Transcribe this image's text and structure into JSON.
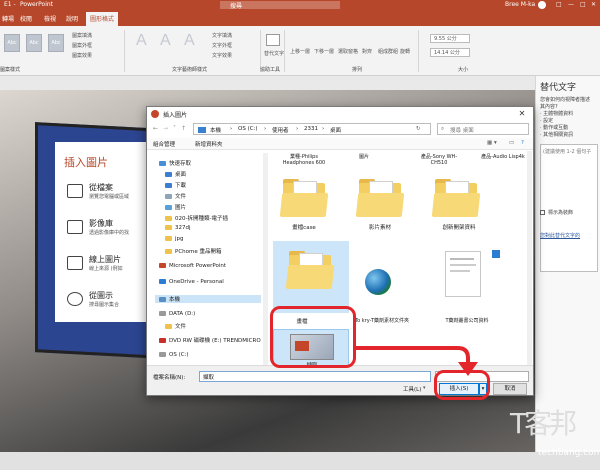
{
  "app": {
    "title": "PowerPoint",
    "title_left": "E1 - ",
    "search": "搜尋",
    "user": "Bree M-ka"
  },
  "ribbon_tabs": [
    "轉場",
    "校閱",
    "檢視",
    "說明",
    "圖形格式"
  ],
  "ribbon_groups": {
    "shape_styles": "圖案樣式",
    "wordart": "文字藝術師樣式",
    "accessibility": "協助工具",
    "arrange": "排列",
    "size": "大小"
  },
  "ribbon_items": {
    "style_box": "Abc",
    "bigA": "A",
    "shape_fill": "圖案填滿",
    "shape_outline": "圖案外框",
    "shape_effect": "圖案效果",
    "text_fill": "文字填滿",
    "text_outline": "文字外框",
    "text_effect": "文字效果",
    "alt_text": "替代文字",
    "bring_forward": "上移一層",
    "send_backward": "下移一層",
    "selection_pane": "選取窗格",
    "align": "對齊",
    "group": "組成群組",
    "rotate": "旋轉",
    "height": "9.55 公分",
    "width": "14.14 公分"
  },
  "slide": {
    "title": "插入圖片",
    "options": [
      {
        "h": "從檔案",
        "d": "瀏覽您電腦或區域"
      },
      {
        "h": "影像庫",
        "d": "透過影像庫中的找"
      },
      {
        "h": "線上圖片",
        "d": "線上來源 (例如"
      },
      {
        "h": "從圖示",
        "d": "搜尋圖示集合"
      }
    ]
  },
  "alt_pane": {
    "title": "替代文字",
    "lines": [
      "您會如何向視障者描述",
      "其內容?",
      "· 主體物體資料",
      "· 設定",
      "· 動作或互動",
      "· 其他相關資訊"
    ],
    "hint": "(建議使用 1-2 個句子",
    "checkbox": "標示為裝飾",
    "link": "您對此替代文字的"
  },
  "dialog": {
    "title": "插入圖片",
    "breadcrumb": [
      "本機",
      "OS (C:)",
      "使用者",
      "2331",
      "桌面"
    ],
    "search_placeholder": "搜尋 桌面",
    "organize": "組合管理",
    "new_folder": "新增資料夾",
    "nav": [
      {
        "label": "快速存取",
        "color": "#4a8fd6"
      },
      {
        "label": "桌面",
        "color": "#3b7fd1"
      },
      {
        "label": "下載",
        "color": "#3b7fd1"
      },
      {
        "label": "文件",
        "color": "#8fa4b8"
      },
      {
        "label": "圖片",
        "color": "#5aa0d8"
      },
      {
        "label": "020-拆開種類-電子插",
        "color": "#f0c24a"
      },
      {
        "label": "327dj",
        "color": "#f0c24a"
      },
      {
        "label": "jpg",
        "color": "#f0c24a"
      },
      {
        "label": "PChome 重品開箱",
        "color": "#f0c24a"
      },
      {
        "label": "Microsoft PowerPoint",
        "color": "#c4462a"
      },
      {
        "label": "OneDrive - Personal",
        "color": "#2b7cd3"
      },
      {
        "label": "本機",
        "color": "#5a8fc4"
      },
      {
        "label": "DATA (D:)",
        "color": "#9a9a9a"
      },
      {
        "label": "文件",
        "color": "#f0c24a"
      },
      {
        "label": "DVD RW 磁碟機 (E:) TRENDMICRO",
        "color": "#c9302c"
      },
      {
        "label": "OS (C:)",
        "color": "#9a9a9a"
      }
    ],
    "top_row_labels": [
      "業種-Philips Headphones 600",
      "圖片",
      "產品-Sony WH-CH510",
      "產品-Audio Lisp4k"
    ],
    "folders": [
      "畫檔case",
      "影片素材",
      "創新開架資料"
    ],
    "row2": [
      "畫檔",
      "To kry-T藥劑素材文件夾",
      "T藥劑叢書公司資料"
    ],
    "selected_file": "擷取",
    "filename_label": "檔案名稱(N):",
    "filename_value": "擷取",
    "tools": "工具(L)",
    "insert": "插入(S)",
    "cancel": "取消"
  },
  "colors": {
    "accent": "#b7472a",
    "annotation": "#e3262b"
  },
  "watermark": "techbang.com"
}
